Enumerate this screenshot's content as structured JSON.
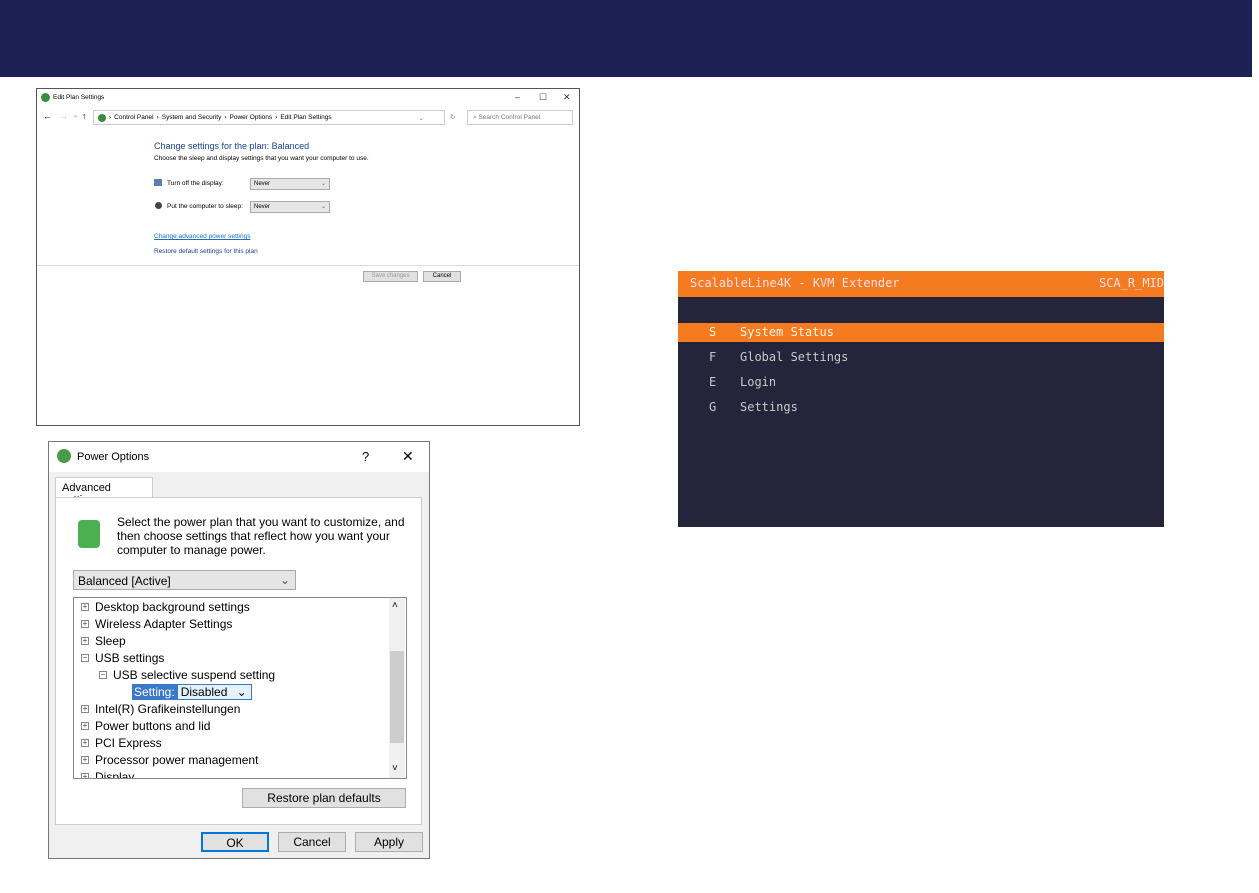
{
  "edit_plan": {
    "title": "Edit Plan Settings",
    "breadcrumb": [
      "Control Panel",
      "System and Security",
      "Power Options",
      "Edit Plan Settings"
    ],
    "search_placeholder": "Search Control Panel",
    "heading": "Change settings for the plan: Balanced",
    "subheading": "Choose the sleep and display settings that you want your computer to use.",
    "display_label": "Turn off the display:",
    "display_value": "Never",
    "sleep_label": "Put the computer to sleep:",
    "sleep_value": "Never",
    "advanced_link": "Change advanced power settings",
    "restore_link": "Restore default settings for this plan",
    "save": "Save changes",
    "cancel": "Cancel"
  },
  "power_options": {
    "title": "Power Options",
    "help": "?",
    "tab": "Advanced settings",
    "intro": "Select the power plan that you want to customize, and then choose settings that reflect how you want your computer to manage power.",
    "plan": "Balanced [Active]",
    "items": [
      {
        "label": "Desktop background settings",
        "sym": "+"
      },
      {
        "label": "Wireless Adapter Settings",
        "sym": "+"
      },
      {
        "label": "Sleep",
        "sym": "+"
      },
      {
        "label": "USB settings",
        "sym": "−"
      },
      {
        "label": "USB selective suspend setting",
        "sym": "−"
      },
      {
        "label": "Intel(R) Grafikeinstellungen",
        "sym": "+"
      },
      {
        "label": "Power buttons and lid",
        "sym": "+"
      },
      {
        "label": "PCI Express",
        "sym": "+"
      },
      {
        "label": "Processor power management",
        "sym": "+"
      },
      {
        "label": "Display",
        "sym": "+"
      }
    ],
    "setting_label": "Setting:",
    "setting_value": "Disabled",
    "restore": "Restore plan defaults",
    "ok": "OK",
    "cancel": "Cancel",
    "apply": "Apply"
  },
  "kvm": {
    "title": "ScalableLine4K - KVM Extender",
    "device": "SCA_R_MID",
    "menu": [
      {
        "key": "S",
        "label": "System Status"
      },
      {
        "key": "F",
        "label": "Global Settings"
      },
      {
        "key": "E",
        "label": "Login"
      },
      {
        "key": "G",
        "label": "Settings"
      }
    ],
    "selected": 0,
    "accent": "#f47b20",
    "bg": "#26243a"
  }
}
